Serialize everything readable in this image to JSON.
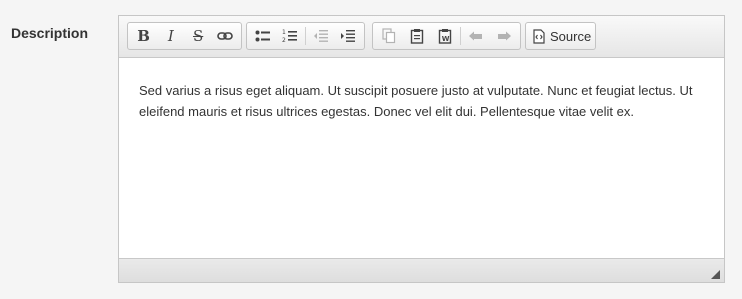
{
  "field": {
    "label": "Description"
  },
  "toolbar": {
    "bold_icon": "bold-icon",
    "italic_icon": "italic-icon",
    "strike_icon": "strikethrough-icon",
    "link_icon": "link-icon",
    "bullets_icon": "bulleted-list-icon",
    "numbers_icon": "numbered-list-icon",
    "outdent_icon": "decrease-indent-icon",
    "indent_icon": "increase-indent-icon",
    "copy_icon": "copy-icon",
    "paste_icon": "paste-icon",
    "paste_word_icon": "paste-from-word-icon",
    "undo_icon": "undo-icon",
    "redo_icon": "redo-icon",
    "source_icon": "source-icon",
    "source_label": "Source"
  },
  "editor": {
    "content": "Sed varius a risus eget aliquam. Ut suscipit posuere justo at vulputate. Nunc et feugiat lectus. Ut eleifend mauris et risus ultrices egestas. Donec vel elit dui. Pellentesque vitae velit ex."
  }
}
